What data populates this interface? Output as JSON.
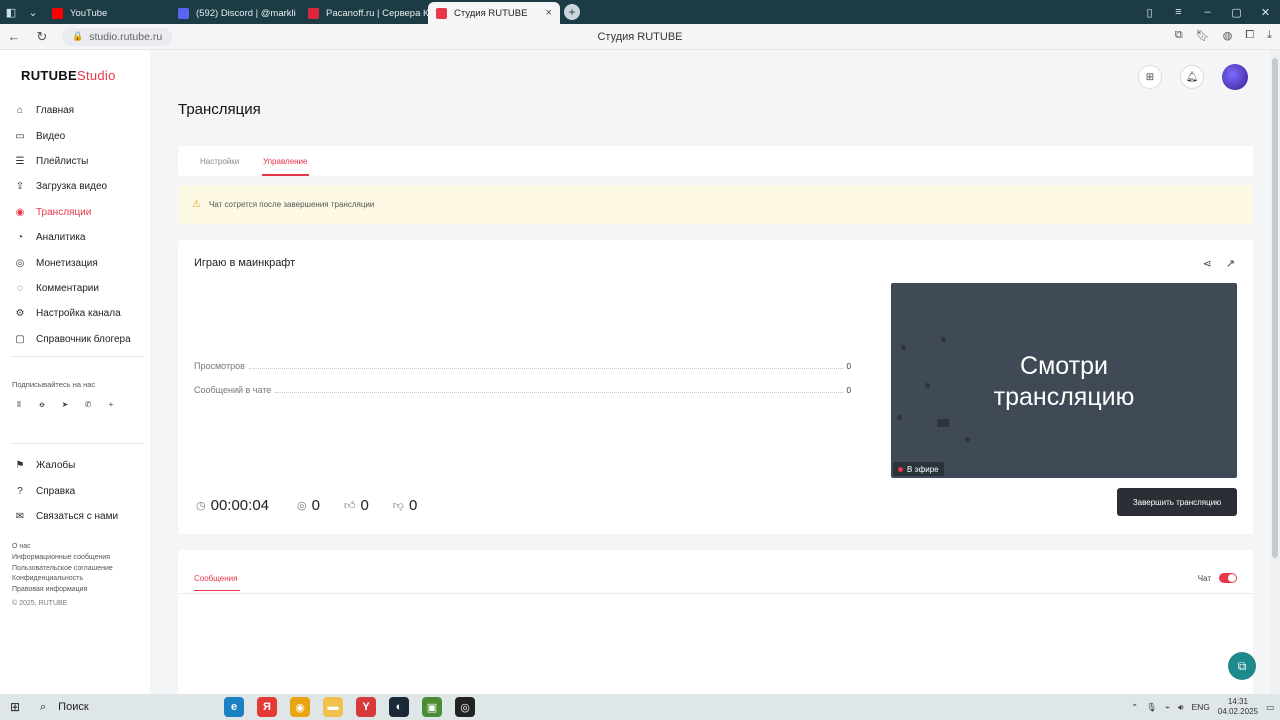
{
  "browser": {
    "tabs": [
      {
        "label": "YouTube",
        "color": "#ff0000"
      },
      {
        "label": "(592) Discord | @markli",
        "color": "#5865f2"
      },
      {
        "label": "Pacanoff.ru | Сервера КС",
        "color": "#d9283b"
      },
      {
        "label": "Студия RUTUBE",
        "color": "#e8364b",
        "active": true
      }
    ],
    "url": "studio.rutube.ru",
    "page_title": "Студия RUTUBE"
  },
  "sidebar": {
    "logo_main": "RUTUBE",
    "logo_accent": "Studio",
    "items": [
      {
        "label": "Главная",
        "icon": "home-icon",
        "glyph": "⌂"
      },
      {
        "label": "Видео",
        "icon": "video-icon",
        "glyph": "▭"
      },
      {
        "label": "Плейлисты",
        "icon": "playlist-icon",
        "glyph": "☰"
      },
      {
        "label": "Загрузка видео",
        "icon": "upload-icon",
        "glyph": "⇪"
      },
      {
        "label": "Трансляции",
        "icon": "broadcast-icon",
        "glyph": "◉",
        "active": true
      },
      {
        "label": "Аналитика",
        "icon": "analytics-icon",
        "glyph": "◔"
      },
      {
        "label": "Монетизация",
        "icon": "money-icon",
        "glyph": "◎"
      },
      {
        "label": "Комментарии",
        "icon": "comments-icon",
        "glyph": "◌"
      },
      {
        "label": "Настройка канала",
        "icon": "settings-icon",
        "glyph": "⚙"
      },
      {
        "label": "Справочник блогера",
        "icon": "guide-icon",
        "glyph": "▢"
      }
    ],
    "subscribe_label": "Подписывайтесь на нас",
    "socials": [
      {
        "icon": "vk-icon",
        "glyph": "ʬ"
      },
      {
        "icon": "ok-icon",
        "glyph": "ꝋ"
      },
      {
        "icon": "telegram-icon",
        "glyph": "➤"
      },
      {
        "icon": "viber-icon",
        "glyph": "✆"
      },
      {
        "icon": "plus-icon",
        "glyph": "+"
      }
    ],
    "items2": [
      {
        "label": "Жалобы",
        "icon": "flag-icon",
        "glyph": "⚑"
      },
      {
        "label": "Справка",
        "icon": "help-icon",
        "glyph": "?"
      },
      {
        "label": "Связаться с нами",
        "icon": "mail-icon",
        "glyph": "✉"
      }
    ],
    "footer_links": [
      "О нас",
      "Информационные сообщения",
      "Пользовательское соглашение",
      "Конфиденциальность",
      "Правовая информация"
    ],
    "copyright": "© 2025, RUTUBE"
  },
  "main": {
    "title": "Трансляция",
    "tabs": [
      "Настройки",
      "Управление"
    ],
    "active_tab": "Управление",
    "warning": "Чат сотрется после завершения трансляции",
    "stream_title": "Играю в маинкрафт",
    "stats": [
      {
        "label": "Просмотров",
        "value": "0"
      },
      {
        "label": "Сообщений в чате",
        "value": "0"
      }
    ],
    "preview_text_1": "Смотри",
    "preview_text_2": "трансляцию",
    "live_badge": "В эфире",
    "duration": "00:00:04",
    "viewers": "0",
    "likes": "0",
    "dislikes": "0",
    "end_button": "Завершить трансляцию",
    "messages_tab": "Сообщения",
    "chat_label": "Чат",
    "chat_enabled": true
  },
  "taskbar": {
    "search_placeholder": "Поиск",
    "lang": "ENG",
    "time": "14:31",
    "date": "04.02.2025"
  }
}
